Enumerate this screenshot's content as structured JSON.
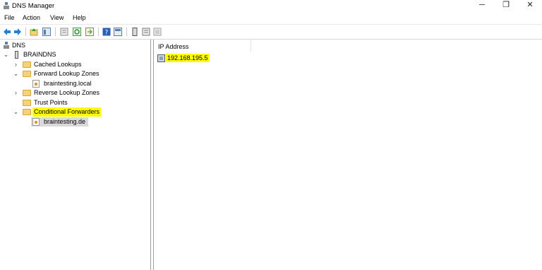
{
  "window": {
    "title": "DNS Manager",
    "minimize": "─",
    "restore": "❐",
    "close": "✕"
  },
  "menu": [
    "File",
    "Action",
    "View",
    "Help"
  ],
  "toolbar_icons": [
    "back-arrow-icon",
    "forward-arrow-icon",
    "up-folder-icon",
    "show-hide-tree-icon",
    "properties-icon",
    "refresh-icon",
    "export-list-icon",
    "help-icon",
    "console-tree-icon",
    "server-icon",
    "list-icon",
    "details-icon"
  ],
  "tree": {
    "root": "DNS",
    "server": "BRAINDNS",
    "items": [
      {
        "label": "Cached Lookups",
        "expander": ">"
      },
      {
        "label": "Forward Lookup Zones",
        "expander": "v"
      },
      {
        "label": "braintesting.local",
        "expander": ""
      },
      {
        "label": "Reverse Lookup Zones",
        "expander": ">"
      },
      {
        "label": "Trust Points",
        "expander": ""
      },
      {
        "label": "Conditional Forwarders",
        "expander": "v"
      },
      {
        "label": "braintesting.de",
        "expander": ""
      }
    ]
  },
  "details": {
    "column": "IP Address",
    "rows": [
      "192.168.195.5"
    ]
  },
  "colors": {
    "highlight": "#ffff00",
    "selected": "#d9d9d9",
    "folder": "#f4d27a"
  }
}
